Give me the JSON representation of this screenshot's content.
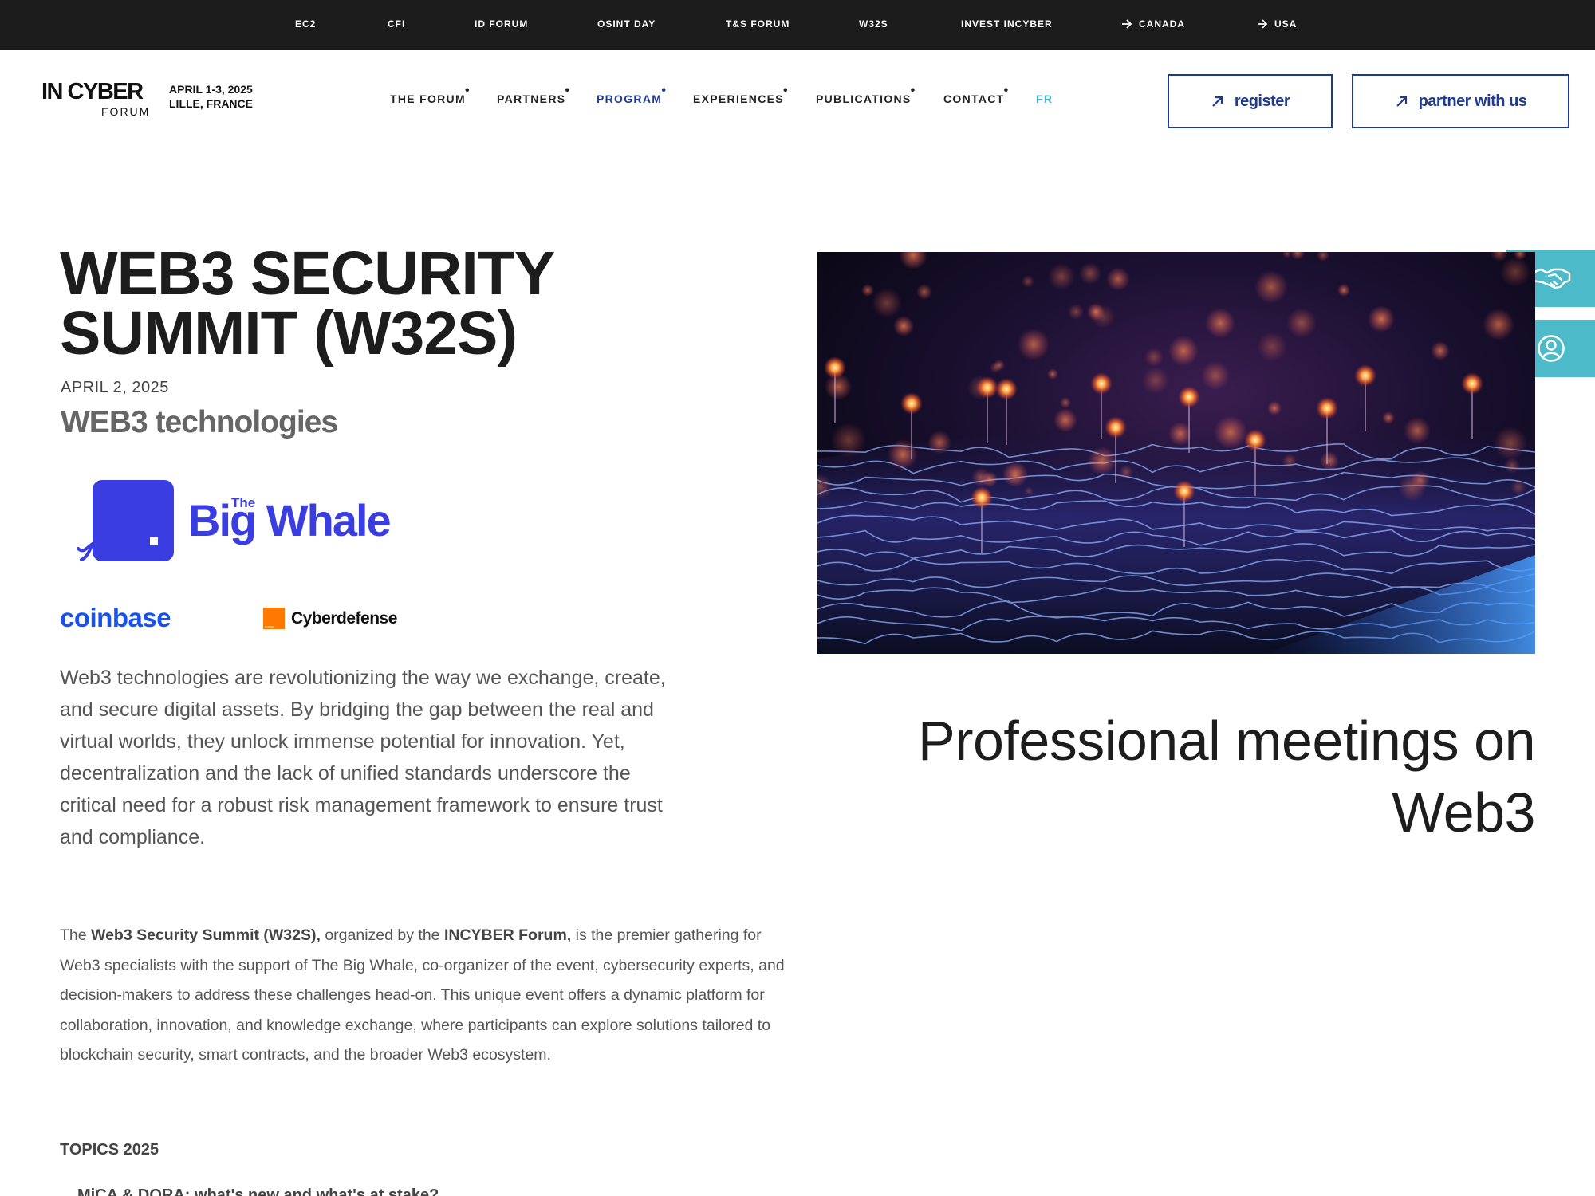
{
  "topbar": {
    "links": [
      "EC2",
      "CFI",
      "ID FORUM",
      "OSINT DAY",
      "T&S FORUM",
      "W32S",
      "INVEST INCYBER"
    ],
    "regions": [
      "CANADA",
      "USA"
    ]
  },
  "header": {
    "logo_main": "IN CYBER",
    "logo_sub": "FORUM",
    "event_dates": "APRIL 1-3, 2025",
    "event_location": "LILLE, FRANCE",
    "nav": [
      "THE FORUM",
      "PARTNERS",
      "PROGRAM",
      "EXPERIENCES",
      "PUBLICATIONS",
      "CONTACT"
    ],
    "lang": "FR",
    "register_label": "register",
    "partner_label": "partner with us"
  },
  "side_tabs": {
    "partner_icon": "handshake-icon",
    "account_icon": "user-circle-icon"
  },
  "main": {
    "title_line1": "WEB3 SECURITY",
    "title_line2": "SUMMIT (W32S)",
    "date": "APRIL 2, 2025",
    "subtitle": "WEB3 technologies",
    "sponsors": {
      "bigwhale_the": "The",
      "bigwhale_name": "Big Whale",
      "coinbase": "coinbase",
      "cyberdefense": "Cyberdefense",
      "orange_mini": "orange"
    },
    "lead": "Web3 technologies are revolutionizing the way we exchange, create, and secure digital assets. By bridging the gap between the real and virtual worlds, they unlock immense potential for innovation. Yet, decentralization and the lack of unified standards underscore the critical need for a robust risk management framework to ensure trust and compliance.",
    "body": {
      "p1": "The ",
      "b1": "Web3 Security Summit (W32S),",
      "p2": " organized by the ",
      "b2": "INCYBER Forum,",
      "p3": " is the premier gathering for Web3 specialists with the support of The Big Whale, co-organizer of the event, cybersecurity experts, and decision-makers to address these challenges head-on. This unique event offers a dynamic platform for collaboration, innovation, and knowledge exchange, where participants can explore solutions tailored to blockchain security, smart contracts, and the broader Web3 ecosystem."
    },
    "topics_heading": "TOPICS 2025",
    "topic_first": "MiCA & DORA: what's new and what's at stake?",
    "tagline_line1": "Professional meetings on",
    "tagline_line2": "Web3"
  },
  "colors": {
    "topbar_bg": "#1c1c1c",
    "brand_blue": "#1f3a8f",
    "accent_teal": "#4cbac8",
    "bigwhale_blue": "#3a3ee0",
    "coinbase_blue": "#1652f0",
    "orange": "#ff7900"
  }
}
